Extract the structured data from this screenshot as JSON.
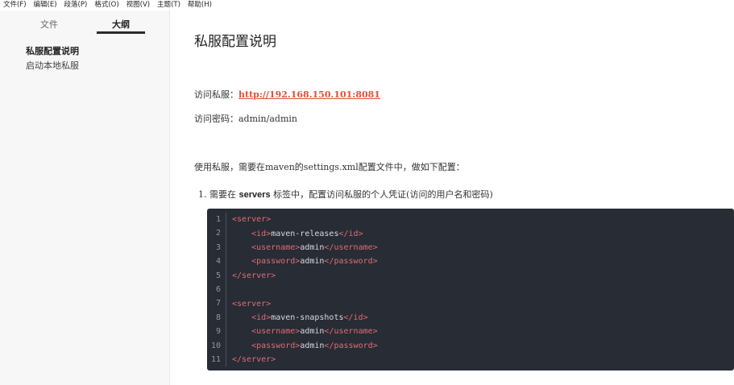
{
  "menu": [
    "文件(F)",
    "编辑(E)",
    "段落(P)",
    "格式(O)",
    "视图(V)",
    "主题(T)",
    "帮助(H)"
  ],
  "sidebar": {
    "tabs": [
      "文件",
      "大纲"
    ],
    "outline": [
      "私服配置说明",
      "启动本地私服"
    ]
  },
  "doc": {
    "title": "私服配置说明",
    "url_label": "访问私服：",
    "url": "http://192.168.150.101:8081",
    "pwd_label": "访问密码：",
    "pwd": "admin/admin",
    "usage": "使用私服，需要在maven的settings.xml配置文件中，做如下配置：",
    "list_prefix": "1. 需要在 ",
    "list_strong": "servers",
    "list_suffix": " 标签中，配置访问私服的个人凭证(访问的用户名和密码)"
  },
  "code": [
    {
      "n": "1",
      "indent": "",
      "open": "<server>",
      "text": "",
      "close": ""
    },
    {
      "n": "2",
      "indent": "    ",
      "open": "<id>",
      "text": "maven-releases",
      "close": "</id>"
    },
    {
      "n": "3",
      "indent": "    ",
      "open": "<username>",
      "text": "admin",
      "close": "</username>"
    },
    {
      "n": "4",
      "indent": "    ",
      "open": "<password>",
      "text": "admin",
      "close": "</password>"
    },
    {
      "n": "5",
      "indent": "",
      "open": "</server>",
      "text": "",
      "close": ""
    },
    {
      "n": "6",
      "indent": "",
      "open": "",
      "text": "",
      "close": ""
    },
    {
      "n": "7",
      "indent": "",
      "open": "<server>",
      "text": "",
      "close": ""
    },
    {
      "n": "8",
      "indent": "    ",
      "open": "<id>",
      "text": "maven-snapshots",
      "close": "</id>"
    },
    {
      "n": "9",
      "indent": "    ",
      "open": "<username>",
      "text": "admin",
      "close": "</username>"
    },
    {
      "n": "10",
      "indent": "    ",
      "open": "<password>",
      "text": "admin",
      "close": "</password>"
    },
    {
      "n": "11",
      "indent": "",
      "open": "</server>",
      "text": "",
      "close": ""
    }
  ]
}
